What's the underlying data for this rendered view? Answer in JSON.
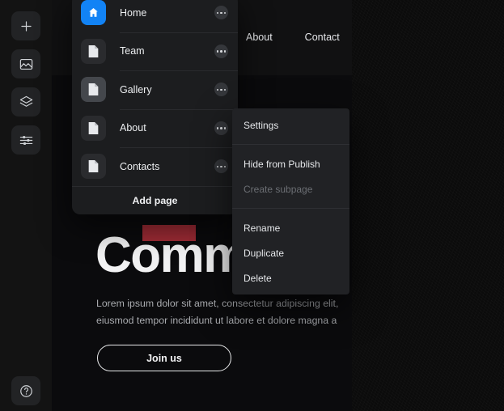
{
  "toolbar": {
    "tools": [
      {
        "name": "add-icon",
        "label": "Add"
      },
      {
        "name": "image-icon",
        "label": "Image"
      },
      {
        "name": "layers-icon",
        "label": "Layers"
      },
      {
        "name": "settings-sliders-icon",
        "label": "Adjust"
      }
    ],
    "help": {
      "name": "help-icon",
      "label": "Help"
    }
  },
  "pages_panel": {
    "items": [
      {
        "label": "Home",
        "icon": "home-icon",
        "state": "selected"
      },
      {
        "label": "Team",
        "icon": "document-icon",
        "state": "default"
      },
      {
        "label": "Gallery",
        "icon": "document-icon",
        "state": "active"
      },
      {
        "label": "About",
        "icon": "document-icon",
        "state": "default"
      },
      {
        "label": "Contacts",
        "icon": "document-icon",
        "state": "default"
      }
    ],
    "add_page_label": "Add page",
    "more_icon": "ellipsis-icon"
  },
  "context_menu": {
    "groups": [
      [
        {
          "label": "Settings",
          "disabled": false
        }
      ],
      [
        {
          "label": "Hide from Publish",
          "disabled": false
        },
        {
          "label": "Create subpage",
          "disabled": true
        }
      ],
      [
        {
          "label": "Rename",
          "disabled": false
        },
        {
          "label": "Duplicate",
          "disabled": false
        },
        {
          "label": "Delete",
          "disabled": false
        }
      ]
    ]
  },
  "canvas": {
    "nav_links": [
      {
        "label": "About"
      },
      {
        "label": "Contact"
      }
    ],
    "hero": {
      "title": "Communit",
      "body": "Lorem ipsum dolor sit amet, consectetur adipiscing elit, eiusmod tempor incididunt ut labore et dolore magna a",
      "cta_label": "Join us",
      "accent_color": "#9e2b35"
    }
  },
  "colors": {
    "accent_blue": "#1283f5",
    "accent_red": "#9e2b35",
    "panel_bg": "#1c1d1f",
    "menu_bg": "#212225"
  }
}
